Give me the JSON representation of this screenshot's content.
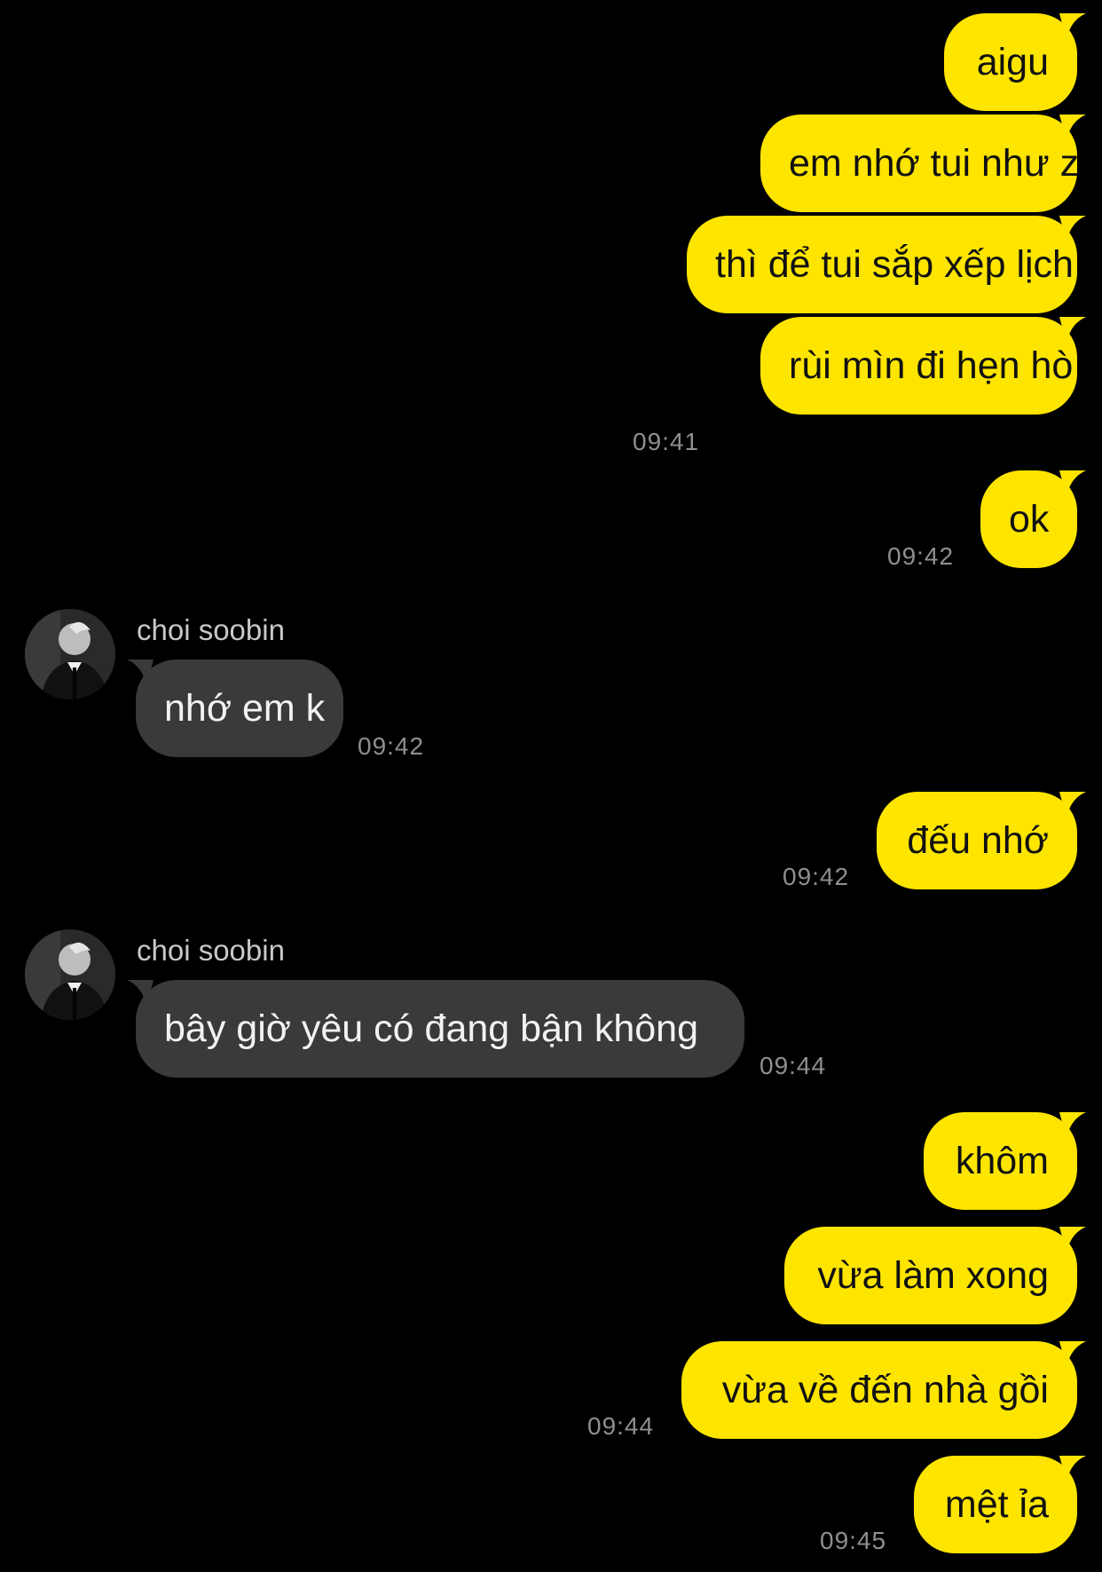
{
  "contact": {
    "name": "choi soobin"
  },
  "colors": {
    "background": "#000000",
    "outgoing_bubble": "#FEE500",
    "incoming_bubble": "#3a3a3c",
    "timestamp": "#8e8e93"
  },
  "messages": [
    {
      "from": "me",
      "text": "aigu"
    },
    {
      "from": "me",
      "text": "em nhớ tui như z"
    },
    {
      "from": "me",
      "text": "thì để tui sắp xếp lịch"
    },
    {
      "from": "me",
      "text": "rùi mìn đi hẹn hò",
      "time": "09:41"
    },
    {
      "from": "me",
      "text": "ok",
      "time": "09:42"
    },
    {
      "from": "other",
      "sender": "choi soobin",
      "text": "nhớ em k",
      "time": "09:42"
    },
    {
      "from": "me",
      "text": "đếu nhớ",
      "time": "09:42"
    },
    {
      "from": "other",
      "sender": "choi soobin",
      "text": "bây giờ yêu có đang bận không",
      "time": "09:44"
    },
    {
      "from": "me",
      "text": "khôm"
    },
    {
      "from": "me",
      "text": "vừa làm xong"
    },
    {
      "from": "me",
      "text": "vừa về đến nhà gồi",
      "time": "09:44"
    },
    {
      "from": "me",
      "text": "mệt ỉa",
      "time": "09:45"
    }
  ],
  "icons": {
    "avatar": "profile-photo-icon"
  }
}
